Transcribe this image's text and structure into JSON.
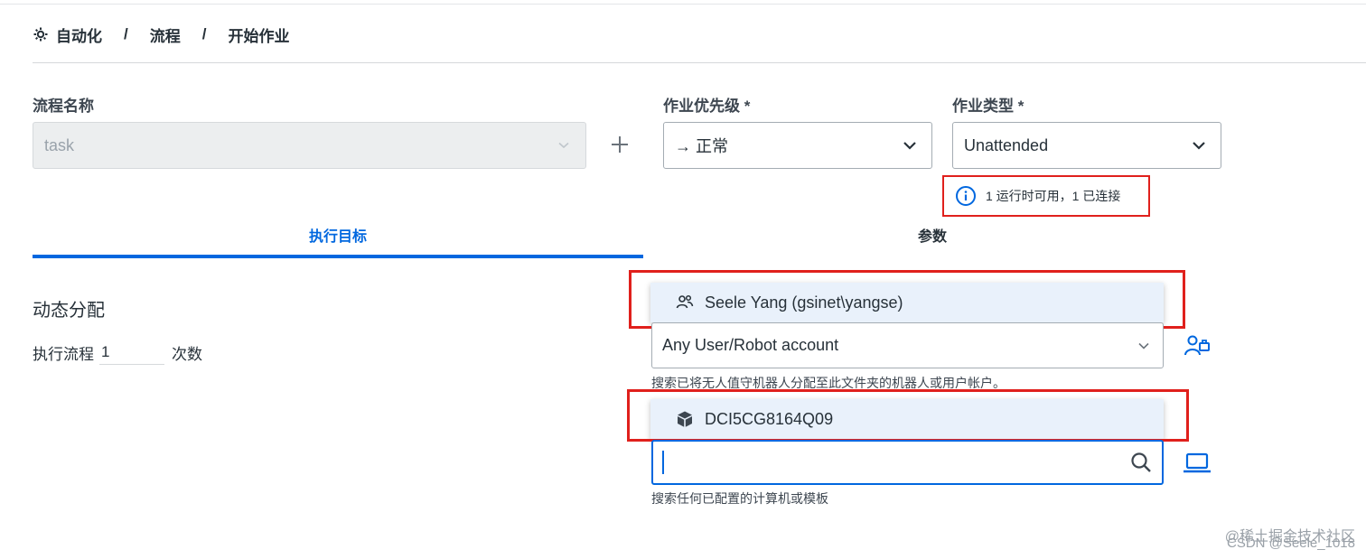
{
  "breadcrumb": {
    "items": [
      "自动化",
      "流程",
      "开始作业"
    ],
    "separator": "/"
  },
  "process_name": {
    "label": "流程名称",
    "value": "task"
  },
  "job_priority": {
    "label": "作业优先级 *",
    "value": "→ 正常"
  },
  "job_type": {
    "label": "作业类型 *",
    "value": "Unattended",
    "info_text": "1 运行时可用，1 已连接"
  },
  "tabs": {
    "execution_target": "执行目标",
    "parameters": "参数"
  },
  "dynamic_allocation": {
    "title": "动态分配",
    "execute_label": "执行流程",
    "execute_count": "1",
    "count_suffix": "次数"
  },
  "account": {
    "dropdown_option": "Seele Yang (gsinet\\yangse)",
    "selected": "Any User/Robot account",
    "help_text": "搜索已将无人值守机器人分配至此文件夹的机器人或用户帐户。"
  },
  "machine": {
    "dropdown_option": "DCI5CG8164Q09",
    "search_value": "",
    "help_text": "搜索任何已配置的计算机或模板"
  },
  "watermark": {
    "line1": "@稀土掘金技术社区",
    "line2": "CSDN @Seele_1018"
  },
  "colors": {
    "accent": "#0067df",
    "highlight_frame": "#e0201c",
    "dropdown_bg": "#e9f1fb"
  }
}
